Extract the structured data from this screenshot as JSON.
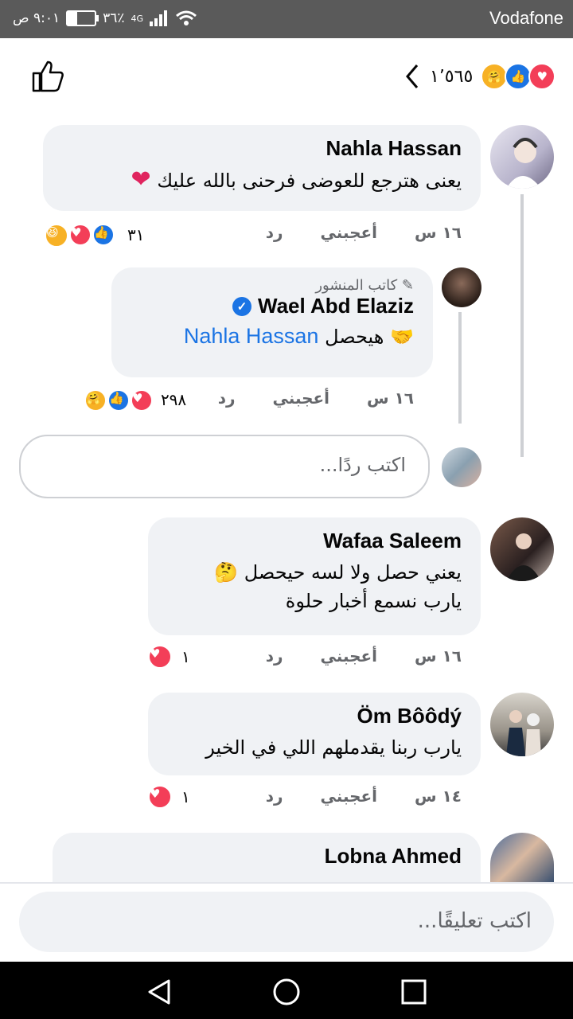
{
  "status_bar": {
    "carrier": "Vodafone",
    "time": "٩:٠١ ص",
    "battery": "٣٦٪",
    "network": "4G"
  },
  "header": {
    "reaction_count": "١٬٥٦٥"
  },
  "comments": [
    {
      "name": "Nahla Hassan",
      "text": "يعنى هترجع للعوضى فرحنى بالله عليك",
      "time": "١٦ س",
      "like": "أعجبني",
      "reply": "رد",
      "reactions": "٣١"
    },
    {
      "author_badge": "كاتب المنشور",
      "name": "Wael Abd Elaziz",
      "text": "هيحصل",
      "mention": "Nahla Hassan",
      "time": "١٦ س",
      "like": "أعجبني",
      "reply": "رد",
      "reactions": "٢٩٨"
    },
    {
      "name": "Wafaa Saleem",
      "text_line1": "يعني حصل ولا لسه حيحصل",
      "text_line2": "يارب نسمع أخبار حلوة",
      "time": "١٦ س",
      "like": "أعجبني",
      "reply": "رد",
      "reactions": "١"
    },
    {
      "name": "Öm Bôôdý",
      "text": "يارب ربنا يقدملهم اللي في الخير",
      "time": "١٤ س",
      "like": "أعجبني",
      "reply": "رد",
      "reactions": "١"
    },
    {
      "name": "Lobna Ahmed"
    }
  ],
  "reply_input": {
    "placeholder": "اكتب ردًا..."
  },
  "comment_input": {
    "placeholder": "اكتب تعليقًا..."
  },
  "colors": {
    "accent": "#1b74e4",
    "love": "#f33e58",
    "bubble": "#f0f2f5",
    "meta": "#65676b"
  },
  "icons": [
    "like-outline-icon",
    "back-chevron-icon",
    "verified-icon",
    "pencil-icon",
    "heart-emoji-icon",
    "handshake-emoji-icon",
    "thinking-emoji-icon",
    "nav-back-icon",
    "nav-home-icon",
    "nav-recents-icon"
  ]
}
